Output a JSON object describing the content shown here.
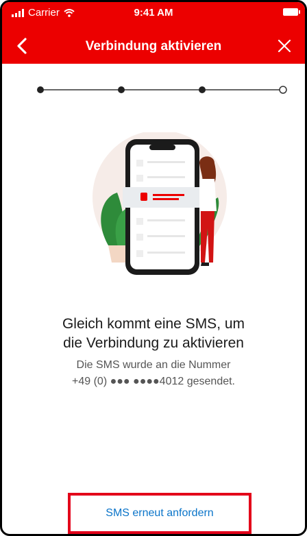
{
  "status_bar": {
    "carrier": "Carrier",
    "time": "9:41 AM"
  },
  "nav": {
    "title": "Verbindung aktivieren",
    "back_icon": "chevron-left-icon",
    "close_icon": "close-icon"
  },
  "progress": {
    "total_steps": 4,
    "completed_steps": 3
  },
  "content": {
    "headline_line1": "Gleich kommt eine SMS, um",
    "headline_line2": "die Verbindung zu aktivieren",
    "sub_line1": "Die SMS wurde an die Nummer",
    "sub_line2": "+49 (0) ●●● ●●●●4012 gesendet."
  },
  "actions": {
    "resend_label": "SMS erneut anfordern"
  },
  "colors": {
    "brand_red": "#ec0000",
    "link_blue": "#0a74c9",
    "highlight_border": "#e3001a"
  }
}
